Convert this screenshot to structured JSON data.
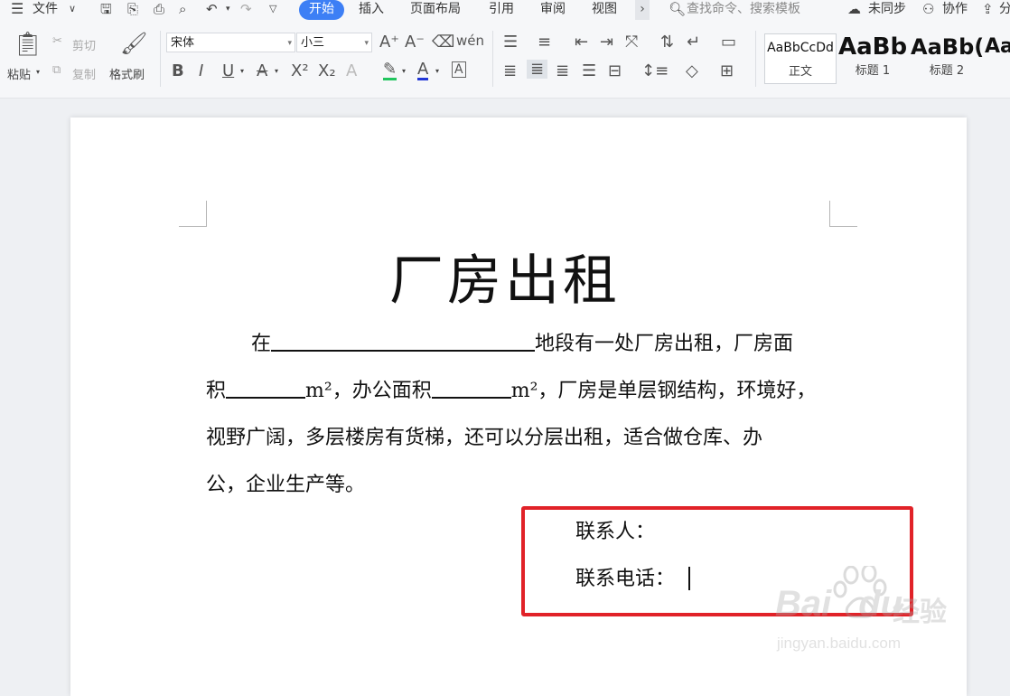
{
  "topbar": {
    "file_menu": "文件",
    "tabs": [
      "开始",
      "插入",
      "页面布局",
      "引用",
      "审阅",
      "视图"
    ],
    "more": "›",
    "search_placeholder": "查找命令、搜索模板",
    "sync_status": "未同步",
    "collaborate": "协作",
    "share": "分"
  },
  "ribbon": {
    "paste": "粘贴",
    "cut": "剪切",
    "copy": "复制",
    "format_painter": "格式刷",
    "font_name": "宋体",
    "font_size": "小三",
    "styles": [
      {
        "sample": "AaBbCcDd",
        "name": "正文"
      },
      {
        "sample": "AaBb",
        "name": "标题 1"
      },
      {
        "sample": "AaBb(",
        "name": "标题 2"
      },
      {
        "sample": "Aa",
        "name": ""
      }
    ]
  },
  "document": {
    "title": "厂房出租",
    "p1_a": "在",
    "p1_b": "地段有一处厂房出租，厂房面",
    "p2_a": "积",
    "p2_b": "m²，办公面积",
    "p2_c": "m²，厂房是单层钢结构，环境好，",
    "p3": "视野广阔，多层楼房有货梯，还可以分层出租，适合做仓库、办",
    "p4": "公，企业生产等。",
    "contact_person": "联系人：",
    "contact_phone": "联系电话："
  },
  "watermark": {
    "brand": "Bai",
    "brand2": "du",
    "cn": "经验",
    "url": "jingyan.baidu.com"
  },
  "colors": {
    "accent": "#3d7ff5",
    "highlight_box": "#e12228"
  }
}
